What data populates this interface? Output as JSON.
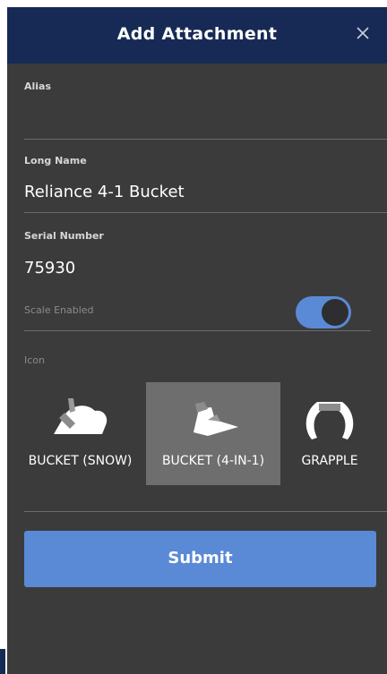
{
  "header": {
    "title": "Add Attachment",
    "close_icon": "close-icon"
  },
  "form": {
    "alias": {
      "label": "Alias",
      "value": ""
    },
    "long_name": {
      "label": "Long Name",
      "value": "Reliance 4-1 Bucket"
    },
    "serial_number": {
      "label": "Serial Number",
      "value": "75930"
    },
    "scale_enabled": {
      "label": "Scale Enabled",
      "on": true
    },
    "icon_section": {
      "label": "Icon",
      "options": [
        {
          "label": "BUCKET (SNOW)",
          "icon": "snow-bucket-icon",
          "selected": false
        },
        {
          "label": "BUCKET (4-IN-1)",
          "icon": "four-in-one-bucket-icon",
          "selected": true
        },
        {
          "label": "GRAPPLE",
          "icon": "grapple-icon",
          "selected": false
        }
      ]
    }
  },
  "submit": {
    "label": "Submit"
  },
  "colors": {
    "header": "#172a55",
    "background": "#3b3b3c",
    "accent": "#5a8ad6",
    "selected_card": "#6e6e6f"
  }
}
